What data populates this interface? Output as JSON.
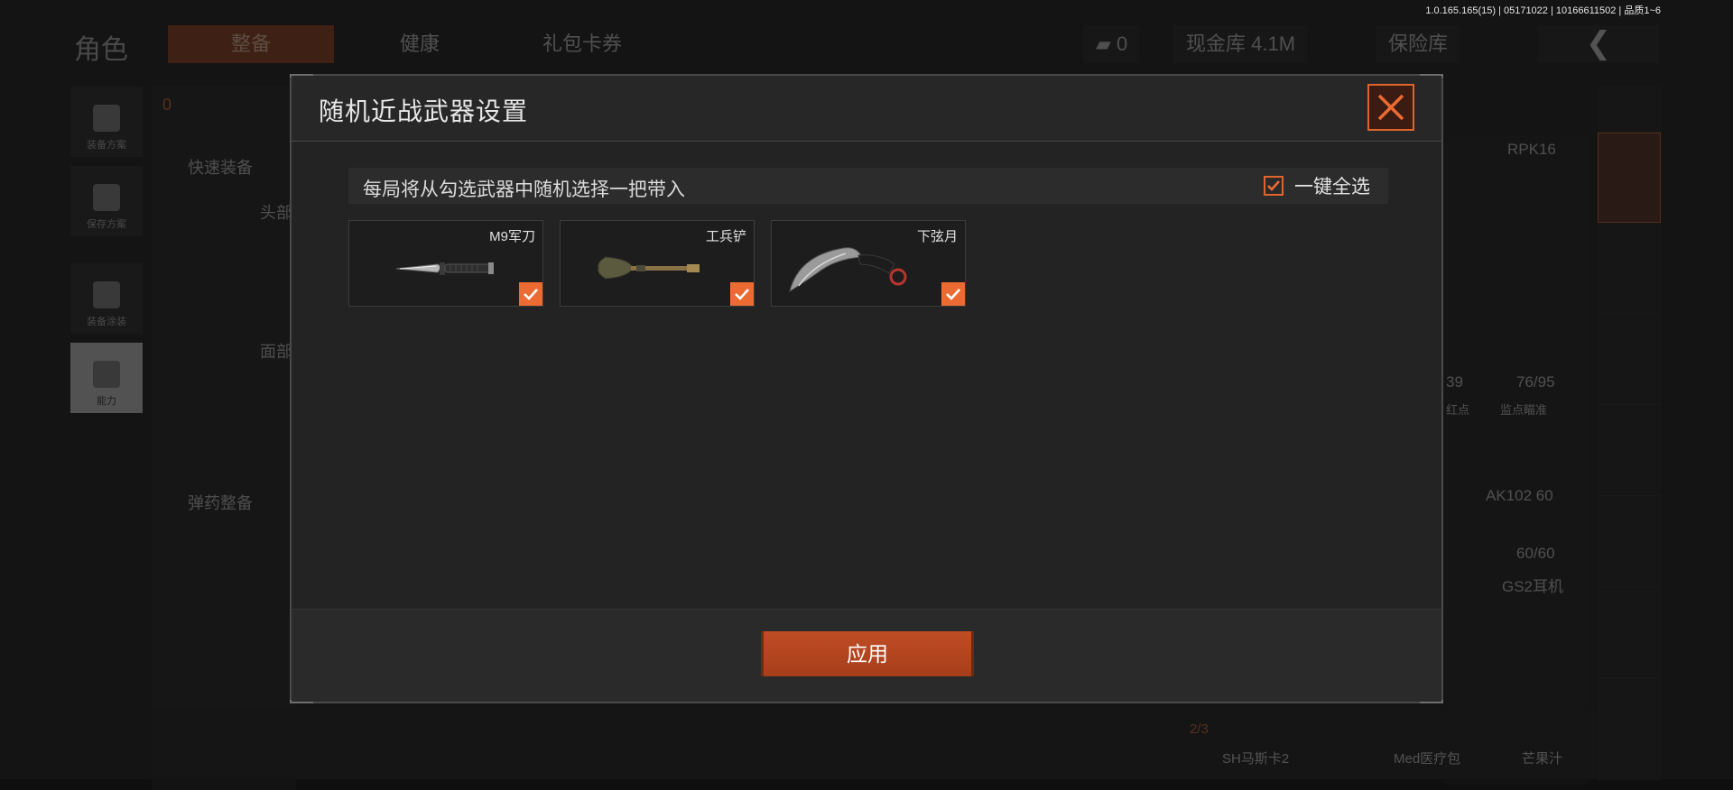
{
  "build_info": "1.0.165.165(15) | 05171022 | 10166611502 | 品质1~6",
  "background": {
    "role_title": "角色",
    "tabs": [
      "整备",
      "健康",
      "礼包卡券"
    ],
    "currency": {
      "value": "0"
    },
    "cash_vault": "现金库 4.1M",
    "insurance": "保险库",
    "left_rail": [
      "装备方案",
      "保存方案",
      "装备涂装",
      "能力"
    ],
    "armor_count": "0",
    "quick_equip": "快速装备",
    "head_label": "头部",
    "face_label": "面部",
    "ammo_label": "弹药整备",
    "right_labels": {
      "rpk": "RPK16",
      "ammo1": "39",
      "ammo2": "76/95",
      "red_dot": "红点",
      "reddot_sight": "监点瞄准",
      "ak": "AK102 60",
      "ak_ammo": "60/60",
      "headset": "GS2耳机",
      "count": "2/3",
      "bottom1": "SH马斯卡2",
      "bottom2": "Med医疗包",
      "bottom3": "芒果汁"
    }
  },
  "modal": {
    "title": "随机近战武器设置",
    "info_text": "每局将从勾选武器中随机选择一把带入",
    "select_all_label": "一键全选",
    "select_all_checked": true,
    "weapons": [
      {
        "name": "M9军刀",
        "checked": true,
        "icon": "bayonet-knife-icon"
      },
      {
        "name": "工兵铲",
        "checked": true,
        "icon": "shovel-icon"
      },
      {
        "name": "下弦月",
        "checked": true,
        "icon": "karambit-icon"
      }
    ],
    "apply_label": "应用"
  },
  "colors": {
    "accent": "#ec6b33",
    "accent_dark": "#a63e1b",
    "modal_bg": "#232323"
  }
}
